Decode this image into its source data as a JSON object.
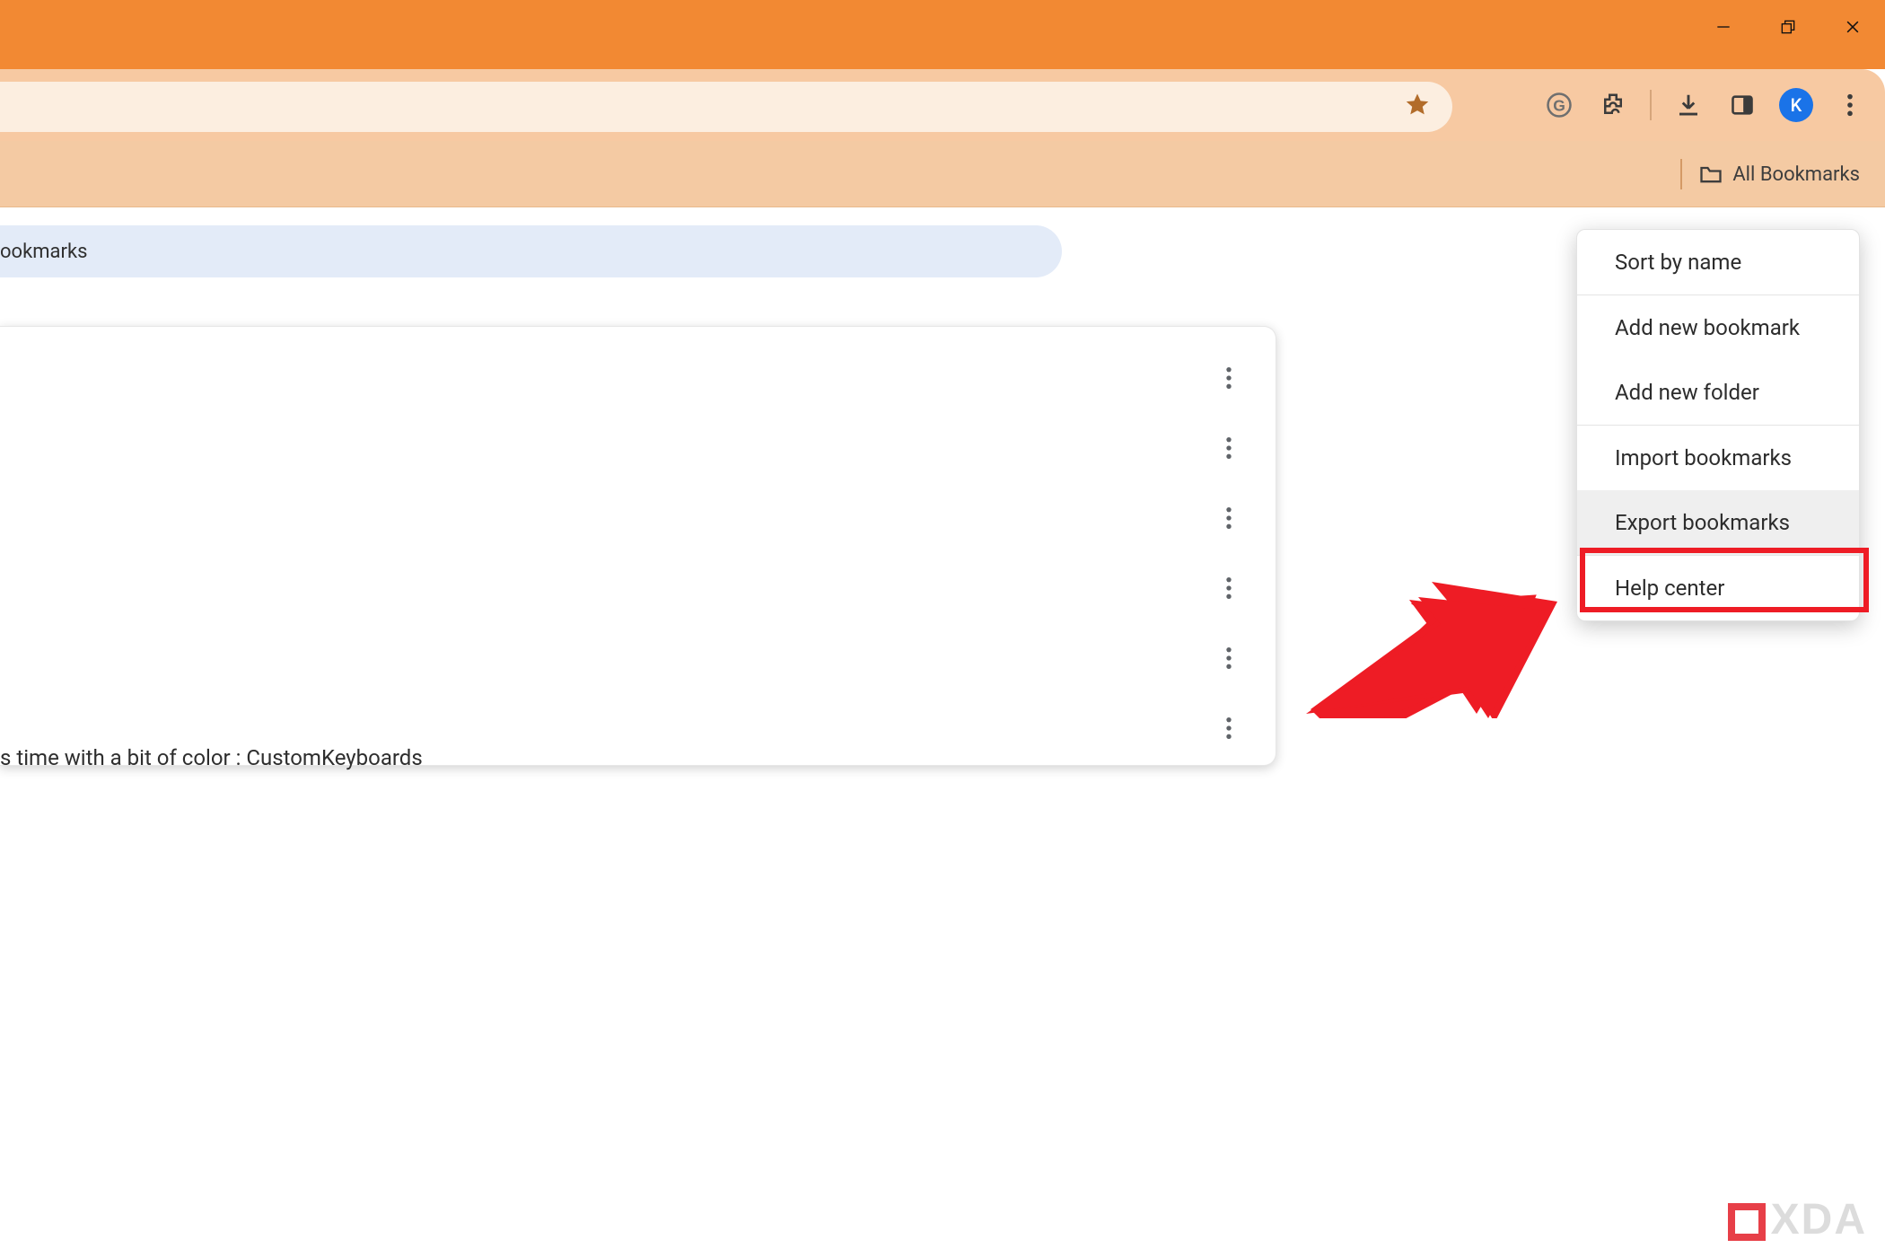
{
  "window": {
    "minimize": "Minimize",
    "maximize": "Restore",
    "close": "Close"
  },
  "toolbar": {
    "star": "Bookmarked",
    "g_icon": "g-translate",
    "ext_icon": "extensions",
    "download_icon": "downloads",
    "sidepanel_icon": "side-panel",
    "profile_letter": "K",
    "menu_icon": "chrome-menu"
  },
  "bookmarks_bar": {
    "all_bookmarks_label": "All Bookmarks"
  },
  "search": {
    "placeholder_fragment": "ookmarks"
  },
  "list": {
    "visible_text_fragment": "s time with a bit of color : CustomKeyboards"
  },
  "menu": {
    "items": [
      "Sort by name",
      "Add new bookmark",
      "Add new folder",
      "Import bookmarks",
      "Export bookmarks",
      "Help center"
    ],
    "highlighted_index": 4
  },
  "watermark": {
    "text": "XDA"
  }
}
